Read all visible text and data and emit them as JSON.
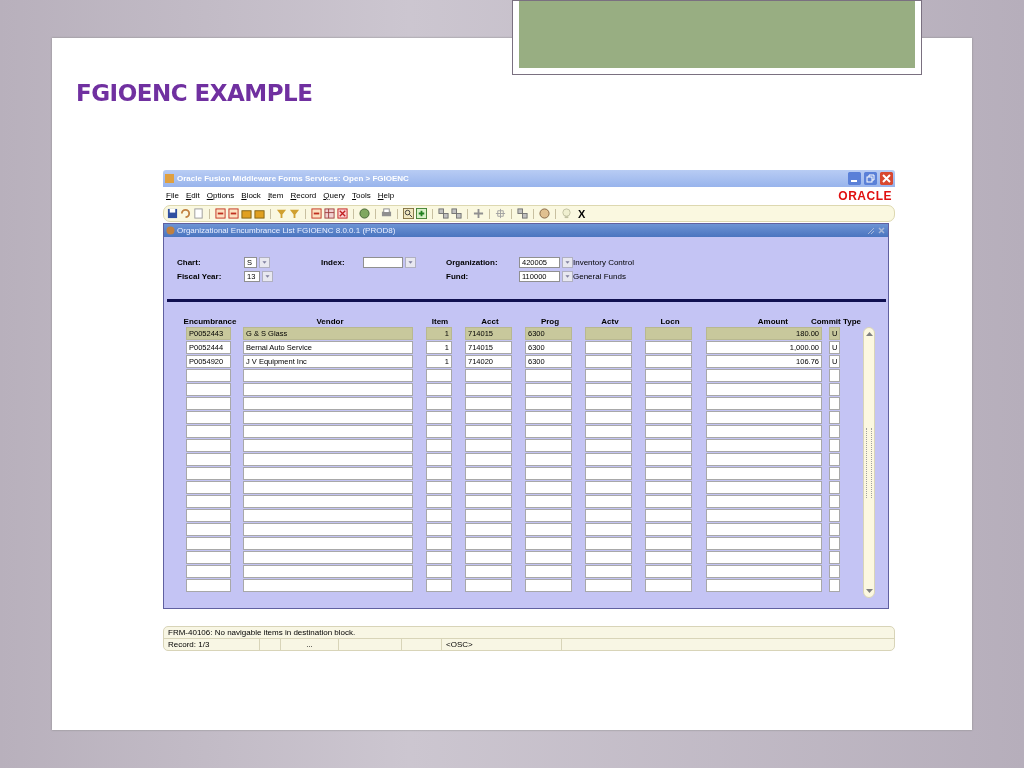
{
  "slide": {
    "title": "FGIOENC EXAMPLE"
  },
  "window": {
    "title": "Oracle Fusion Middleware Forms Services:  Open > FGIOENC",
    "logo": "ORACLE"
  },
  "menu": [
    "File",
    "Edit",
    "Options",
    "Block",
    "Item",
    "Record",
    "Query",
    "Tools",
    "Help"
  ],
  "toolbar": {
    "exit_label": "X"
  },
  "form": {
    "title": "Organizational Encumbrance List  FGIOENC  8.0.0.1  (PROD8)",
    "chart": {
      "label": "Chart:",
      "value": "S"
    },
    "fiscal_year": {
      "label": "Fiscal Year:",
      "value": "13"
    },
    "index": {
      "label": "Index:"
    },
    "organization": {
      "label": "Organization:",
      "value": "420005",
      "description": "Inventory Control"
    },
    "fund": {
      "label": "Fund:",
      "value": "110000",
      "description": "General Funds"
    },
    "columns": [
      "Encumbrance",
      "Vendor",
      "Item",
      "Acct",
      "Prog",
      "Actv",
      "Locn",
      "Amount",
      "Commit Type"
    ],
    "rows": [
      {
        "encumbrance": "P0052443",
        "vendor": "G & S Glass",
        "item": "1",
        "acct": "714015",
        "prog": "6300",
        "amount": "180.00",
        "commit_type": "U",
        "selected": true
      },
      {
        "encumbrance": "P0052444",
        "vendor": "Bernal Auto Service",
        "item": "1",
        "acct": "714015",
        "prog": "6300",
        "amount": "1,000.00",
        "commit_type": "U",
        "selected": false
      },
      {
        "encumbrance": "P0054920",
        "vendor": "J V Equipment Inc",
        "item": "1",
        "acct": "714020",
        "prog": "6300",
        "amount": "106.76",
        "commit_type": "U",
        "selected": false
      },
      {
        "selected": false
      },
      {
        "selected": false
      },
      {
        "selected": false
      },
      {
        "selected": false
      },
      {
        "selected": false
      },
      {
        "selected": false
      },
      {
        "selected": false
      },
      {
        "selected": false
      },
      {
        "selected": false
      },
      {
        "selected": false
      },
      {
        "selected": false
      },
      {
        "selected": false
      },
      {
        "selected": false
      },
      {
        "selected": false
      },
      {
        "selected": false
      },
      {
        "selected": false
      }
    ]
  },
  "status_bar": {
    "message": "FRM-40106: No navigable items in destination block.",
    "record": "Record: 1/3",
    "field_3": "...",
    "mode": "<OSC>"
  }
}
